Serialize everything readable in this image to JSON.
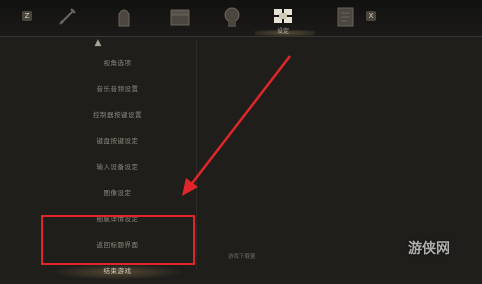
{
  "top_nav": {
    "left_key": "Z",
    "right_key": "X",
    "active_tab_label": "设定",
    "tabs": [
      {
        "icon": "sword-icon"
      },
      {
        "icon": "armor-icon"
      },
      {
        "icon": "chest-icon"
      },
      {
        "icon": "head-profile-icon"
      },
      {
        "icon": "settings-cubes-icon"
      },
      {
        "icon": "journal-icon"
      }
    ]
  },
  "menu": {
    "items": [
      "视角选项",
      "音乐音频设置",
      "控制器按键设置",
      "键盘按键设定",
      "输入设备设定",
      "图像设定",
      "细腻详情设定",
      "返回标题界面",
      "结束游戏"
    ],
    "selected_index": 8
  },
  "description": "游戏下载量",
  "watermark": "游侠网",
  "colors": {
    "background": "#1f1e1b",
    "highlight": "#e0262a",
    "arrow": "#e0262a"
  }
}
